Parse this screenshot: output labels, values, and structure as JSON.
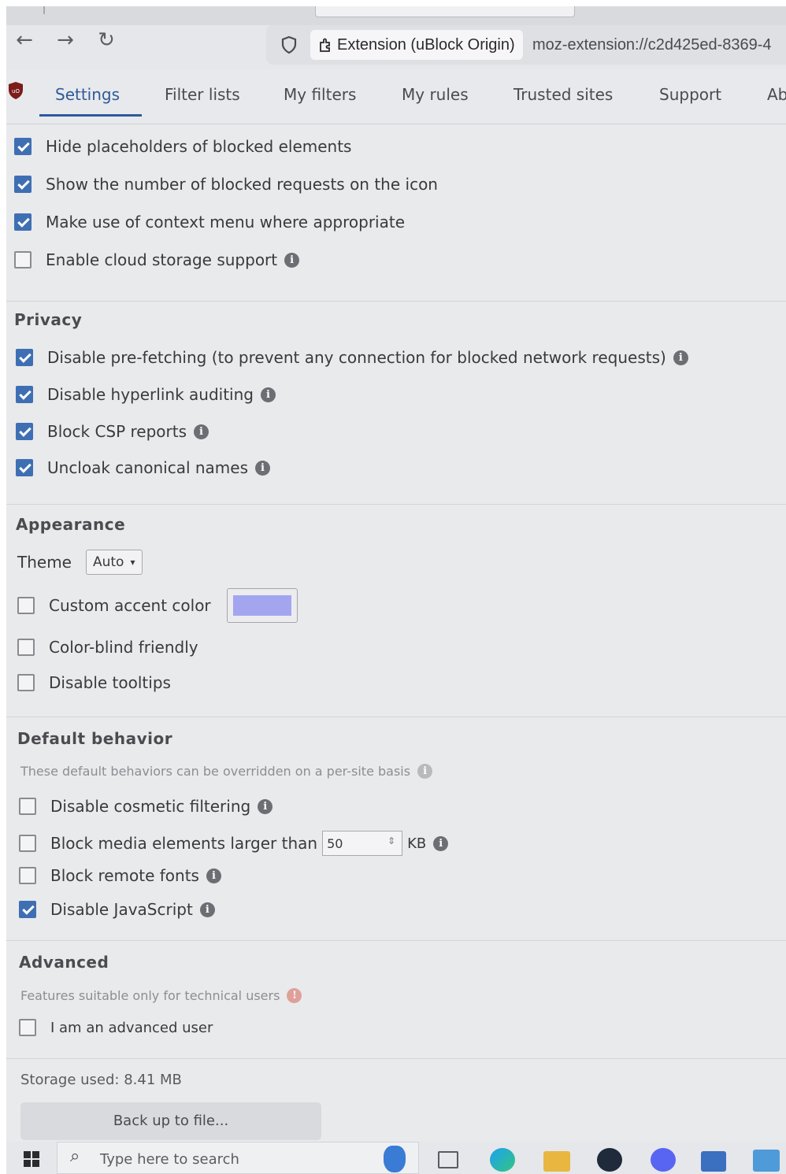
{
  "browser": {
    "identity_label": "Extension (uBlock Origin)",
    "url": "moz-extension://c2d425ed-8369-4"
  },
  "tabs": [
    {
      "label": "Settings",
      "active": true
    },
    {
      "label": "Filter lists",
      "active": false
    },
    {
      "label": "My filters",
      "active": false
    },
    {
      "label": "My rules",
      "active": false
    },
    {
      "label": "Trusted sites",
      "active": false
    },
    {
      "label": "Support",
      "active": false
    },
    {
      "label": "Ab",
      "active": false
    }
  ],
  "general": [
    {
      "label": "Hide placeholders of blocked elements",
      "checked": true,
      "info": false
    },
    {
      "label": "Show the number of blocked requests on the icon",
      "checked": true,
      "info": false
    },
    {
      "label": "Make use of context menu where appropriate",
      "checked": true,
      "info": false
    },
    {
      "label": "Enable cloud storage support",
      "checked": false,
      "info": true
    }
  ],
  "privacy": {
    "title": "Privacy",
    "items": [
      {
        "label": "Disable pre-fetching (to prevent any connection for blocked network requests)",
        "checked": true
      },
      {
        "label": "Disable hyperlink auditing",
        "checked": true
      },
      {
        "label": "Block CSP reports",
        "checked": true
      },
      {
        "label": "Uncloak canonical names",
        "checked": true
      }
    ]
  },
  "appearance": {
    "title": "Appearance",
    "theme_label": "Theme",
    "theme_value": "Auto",
    "accent_label": "Custom accent color",
    "accent_checked": false,
    "accent_color": "#a3a6ee",
    "colorblind_label": "Color-blind friendly",
    "colorblind_checked": false,
    "tooltips_label": "Disable tooltips",
    "tooltips_checked": false
  },
  "default_behavior": {
    "title": "Default behavior",
    "subtitle": "These default behaviors can be overridden on a per-site basis",
    "cosmetic_label": "Disable cosmetic filtering",
    "cosmetic_checked": false,
    "media_label": "Block media elements larger than",
    "media_value": "50",
    "media_unit": "KB",
    "media_checked": false,
    "fonts_label": "Block remote fonts",
    "fonts_checked": false,
    "js_label": "Disable JavaScript",
    "js_checked": true
  },
  "advanced": {
    "title": "Advanced",
    "subtitle": "Features suitable only for technical users",
    "user_label": "I am an advanced user",
    "user_checked": false
  },
  "storage": {
    "used_label": "Storage used: 8.41 MB",
    "backup_label": "Back up to file..."
  },
  "taskbar": {
    "search_placeholder": "Type here to search"
  },
  "colors": {
    "accent": "#3f6fb3",
    "tab_active": "#2e5a99"
  }
}
